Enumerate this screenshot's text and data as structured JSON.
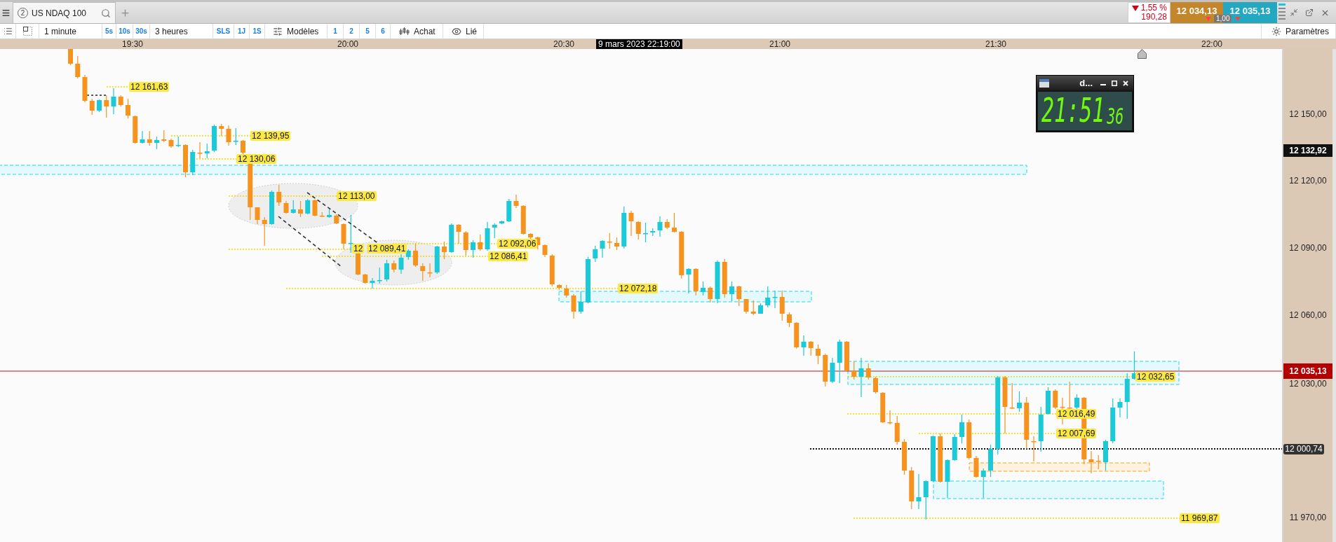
{
  "tab_bar": {
    "tabs": [
      {
        "number": "2",
        "label": "US NDAQ 100",
        "selected": true
      }
    ]
  },
  "quote": {
    "change_percent": "1,55 %",
    "change_points": "190,28",
    "sell": "12 034,13",
    "buy": "12 035,13",
    "spread": "1,00"
  },
  "toolbar": {
    "interval": "1 minute",
    "interval_presets": [
      "5s",
      "10s",
      "30s"
    ],
    "range": "3 heures",
    "range_presets": [
      "SLS",
      "1J",
      "1S"
    ],
    "templates": "Modèles",
    "layouts": [
      "1",
      "2",
      "5",
      "6"
    ],
    "order": "Achat",
    "linked": "Lié",
    "settings": "Paramètres"
  },
  "time_axis": {
    "ticks": [
      "19:30",
      "20:00",
      "20:30",
      "21:00",
      "21:30",
      "22:00"
    ],
    "cursor_label": "9 mars 2023 22:19:00"
  },
  "chart": {
    "price_tags": [
      "12 161,63",
      "12 139,95",
      "12 130,06",
      "12 113,00",
      "12",
      "12 089,41",
      "12 092,06",
      "12 086,41",
      "12 072,18",
      "12 032,65",
      "12 016,49",
      "12 007,69",
      "11 969,87"
    ],
    "clock": {
      "title": "d...",
      "time": "21:51",
      "seconds": "36"
    }
  },
  "price_axis": {
    "ticks": [
      "12 150,00",
      "12 120,00",
      "12 090,00",
      "12 060,00",
      "12 030,00",
      "11 970,00"
    ],
    "markers": [
      {
        "kind": "cursor",
        "label": "12 132,92"
      },
      {
        "kind": "last",
        "label": "12 035,13"
      },
      {
        "kind": "reference",
        "label": "12 000,74"
      }
    ]
  }
}
